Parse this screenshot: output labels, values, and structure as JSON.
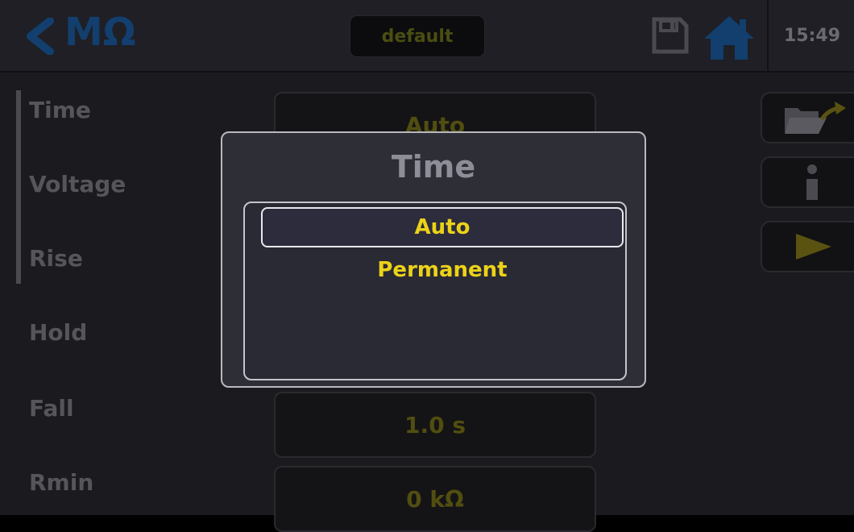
{
  "header": {
    "title": "MΩ",
    "profile_label": "default",
    "time": "15:49",
    "icons": [
      "chevron-left-icon",
      "save-icon",
      "home-icon"
    ]
  },
  "parameters": [
    {
      "label": "Time"
    },
    {
      "label": "Voltage"
    },
    {
      "label": "Rise"
    },
    {
      "label": "Hold"
    },
    {
      "label": "Fall",
      "value": "1.0 s"
    },
    {
      "label": "Rmin",
      "value": "0 kΩ"
    }
  ],
  "time_field_value": "Auto",
  "side_buttons": [
    "folder-export-icon",
    "info-icon",
    "play-icon"
  ],
  "dialog": {
    "title": "Time",
    "options": [
      "Auto",
      "Permanent"
    ],
    "selected": "Auto"
  },
  "colors": {
    "accent_yellow": "#ecd218",
    "brand_blue": "#1a5a9a",
    "background": "#1b1b1f"
  }
}
